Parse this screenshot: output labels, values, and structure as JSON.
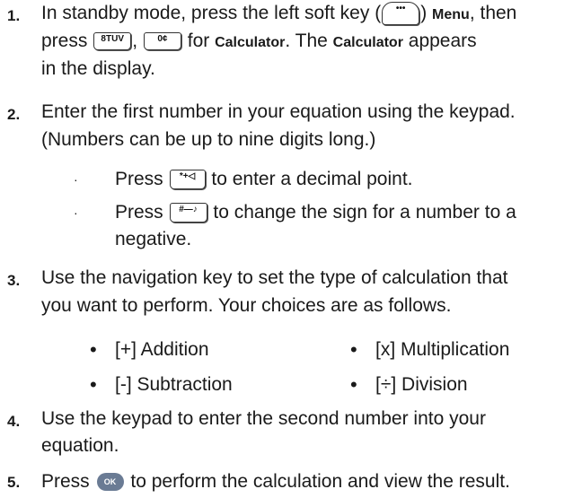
{
  "steps": [
    {
      "num": "1.",
      "line1": {
        "t1": "In standby mode, press the left soft key (",
        "key_soft": "•••",
        "t2": ")",
        "menu": "Menu",
        "t3": ", then"
      },
      "line2": {
        "t1": "press",
        "key8": "8TUV",
        "comma": ",",
        "key0": "0¢",
        "t2": "for",
        "calc": "Calculator",
        "t3": ". The",
        "calc2": "Calculator",
        "t4": "appears"
      },
      "line3": "in the display."
    },
    {
      "num": "2.",
      "line1": "Enter the first number in your equation using the keypad.",
      "line2": "(Numbers can be up to nine digits long.)",
      "subs": [
        {
          "bullet": "·",
          "t1": "Press",
          "key": "*+◁",
          "t2": "to enter a decimal point."
        },
        {
          "bullet": "·",
          "t1": "Press",
          "key": "#—♪",
          "t2": "to change the sign for a number to a",
          "t3": "negative."
        }
      ]
    },
    {
      "num": "3.",
      "line1": "Use the navigation key to set the type of calculation that",
      "line2": "you want to perform. Your choices are as follows.",
      "options": [
        {
          "bullet": "•",
          "label": "[+] Addition"
        },
        {
          "bullet": "•",
          "label": "[x] Multiplication"
        },
        {
          "bullet": "•",
          "label": "[-] Subtraction"
        },
        {
          "bullet": "•",
          "label": "[÷] Division"
        }
      ]
    },
    {
      "num": "4.",
      "line1": "Use the keypad to enter the second number into your",
      "line2": "equation."
    },
    {
      "num": "5.",
      "t1": "Press",
      "ok": "OK",
      "t2": "to perform the calculation and view the result."
    }
  ]
}
